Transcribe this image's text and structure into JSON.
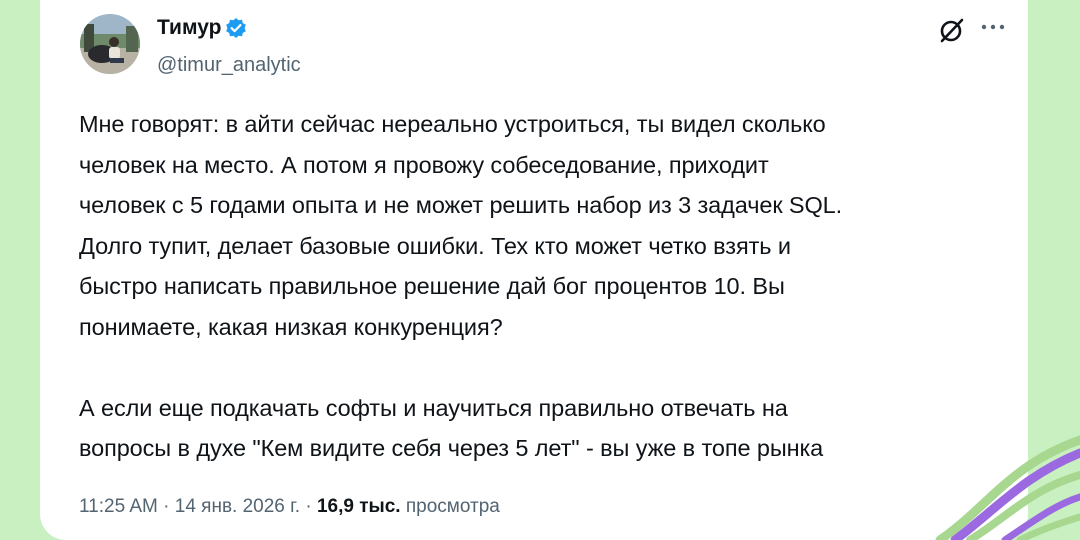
{
  "author": {
    "name": "Тимур",
    "handle": "@timur_analytic"
  },
  "tweet": {
    "lines": [
      "Мне говорят: в айти сейчас нереально устроиться, ты видел сколько",
      "человек на место. А потом я провожу собеседование, приходит",
      "человек с 5 годами опыта и не может решить набор из 3 задачек SQL.",
      "Долго тупит, делает базовые ошибки. Тех кто может четко взять и",
      "быстро написать правильное решение дай бог процентов 10. Вы",
      "понимаете, какая низкая конкуренция?",
      "",
      "А если еще подкачать софты и научиться правильно отвечать на",
      "вопросы в духе \"Кем видите себя через 5 лет\" - вы уже в топе рынка"
    ]
  },
  "meta": {
    "time": "11:25 AM",
    "separator": "·",
    "date": "14 янв. 2026 г.",
    "views_count": "16,9 тыс.",
    "views_label": "просмотра"
  },
  "colors": {
    "background": "#c8f0c0",
    "card": "#ffffff",
    "text": "#0f1419",
    "secondary_text": "#536471",
    "verified_badge": "#1d9bf0",
    "decor_purple": "#9b6ae0",
    "decor_green": "#a8d890"
  },
  "icons": {
    "verified": "verified-badge-icon",
    "grok": "grok-icon",
    "more": "more-horizontal-icon"
  }
}
